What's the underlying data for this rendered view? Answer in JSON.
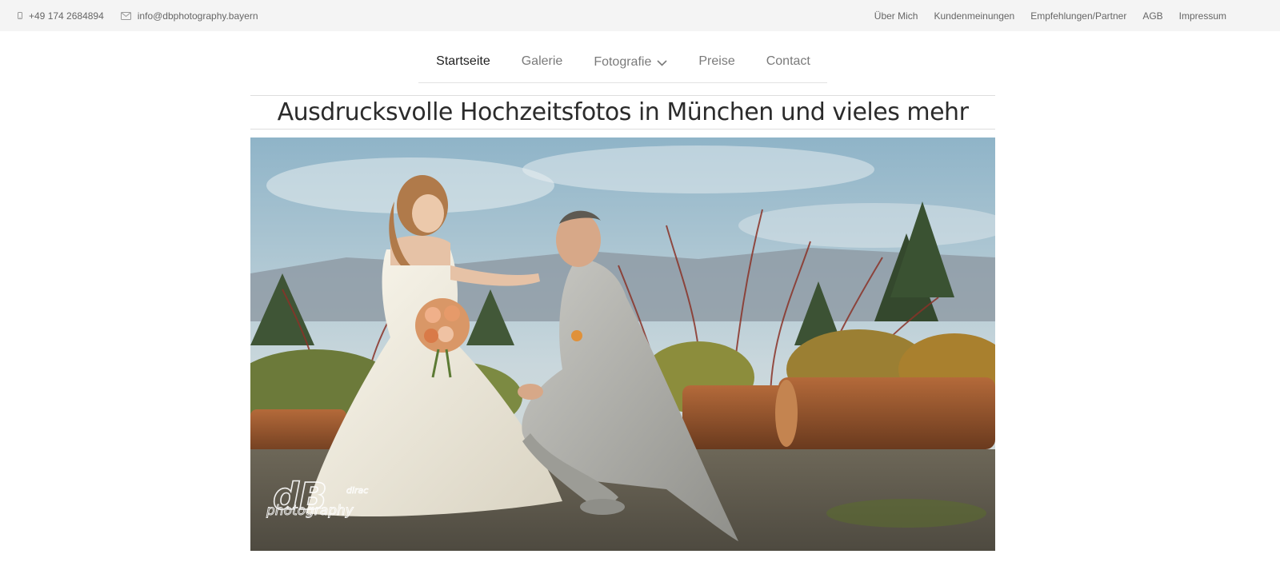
{
  "topbar": {
    "phone": "+49 174 2684894",
    "email": "info@dbphotography.bayern",
    "links": [
      "Über Mich",
      "Kundenmeinungen",
      "Empfehlungen/Partner",
      "AGB",
      "Impressum"
    ]
  },
  "nav": {
    "items": [
      {
        "label": "Startseite",
        "active": true
      },
      {
        "label": "Galerie",
        "active": false
      },
      {
        "label": "Fotografie",
        "active": false,
        "has_dropdown": true
      },
      {
        "label": "Preise",
        "active": false
      },
      {
        "label": "Contact",
        "active": false
      }
    ]
  },
  "headline": "Ausdrucksvolle Hochzeitsfotos in München und vieles mehr",
  "hero": {
    "watermark": "dB photography"
  },
  "colors": {
    "topbar_bg": "#f4f4f4",
    "text_muted": "#666666",
    "nav_active": "#222222",
    "nav_inactive": "#7a7a7a",
    "rule": "#dddddd"
  }
}
